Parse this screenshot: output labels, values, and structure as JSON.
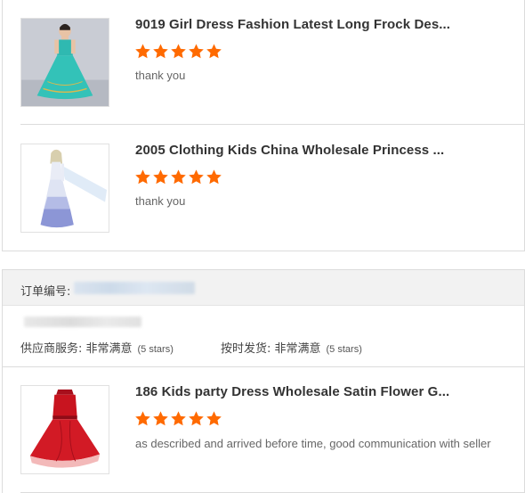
{
  "colors": {
    "star": "#ff6a00",
    "border": "#dcdcdc",
    "order_bar_bg": "#f2f2f2"
  },
  "reviews_top": [
    {
      "title": "9019 Girl Dress Fashion Latest Long Frock Des...",
      "rating": 5,
      "comment": "thank you",
      "image_icon": "teal-princess-dress-image"
    },
    {
      "title": "2005 Clothing Kids China Wholesale Princess ...",
      "rating": 5,
      "comment": "thank you",
      "image_icon": "white-princess-dress-image"
    }
  ],
  "order": {
    "number_label": "订单编号:",
    "supplier_service_label": "供应商服务: 非常满意",
    "supplier_service_note": "(5 stars)",
    "shipping_label": "按时发货: 非常满意",
    "shipping_note": "(5 stars)"
  },
  "reviews_bottom": [
    {
      "title": "186 Kids party Dress Wholesale Satin Flower G...",
      "rating": 5,
      "comment": "as described and arrived before time, good communication with seller",
      "image_icon": "red-party-dress-image"
    }
  ]
}
